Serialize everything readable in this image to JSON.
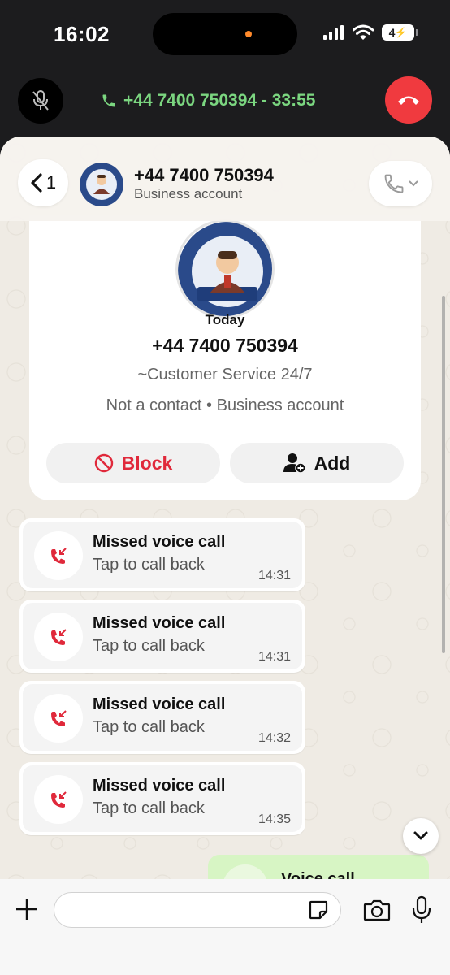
{
  "status_bar": {
    "time": "16:02",
    "battery": "4"
  },
  "active_call": {
    "label": "+44 7400 750394 - 33:55"
  },
  "header": {
    "back_count": "1",
    "name": "+44 7400 750394",
    "subtitle": "Business account"
  },
  "info_card": {
    "date_label": "Today",
    "number": "+44 7400 750394",
    "name": "~Customer Service 24/7",
    "status": "Not a contact • Business account",
    "block_label": "Block",
    "add_label": "Add"
  },
  "messages": [
    {
      "title": "Missed voice call",
      "subtitle": "Tap to call back",
      "time": "14:31"
    },
    {
      "title": "Missed voice call",
      "subtitle": "Tap to call back",
      "time": "14:31"
    },
    {
      "title": "Missed voice call",
      "subtitle": "Tap to call back",
      "time": "14:32"
    },
    {
      "title": "Missed voice call",
      "subtitle": "Tap to call back",
      "time": "14:35"
    }
  ],
  "outgoing_preview": {
    "text": "Voice call"
  },
  "input": {
    "placeholder": ""
  },
  "colors": {
    "call_green": "#7bd680",
    "end_call_red": "#f03a3f",
    "block_red": "#e0293b",
    "missed_call_red": "#e0293b",
    "outgoing_bubble": "#d7f5c4"
  },
  "icons": [
    "mic-off-icon",
    "phone-icon",
    "end-call-icon",
    "chevron-left-icon",
    "phone-outline-icon",
    "chevron-down-icon",
    "block-icon",
    "add-person-icon",
    "missed-call-icon",
    "plus-icon",
    "sticker-icon",
    "camera-icon",
    "microphone-icon"
  ]
}
